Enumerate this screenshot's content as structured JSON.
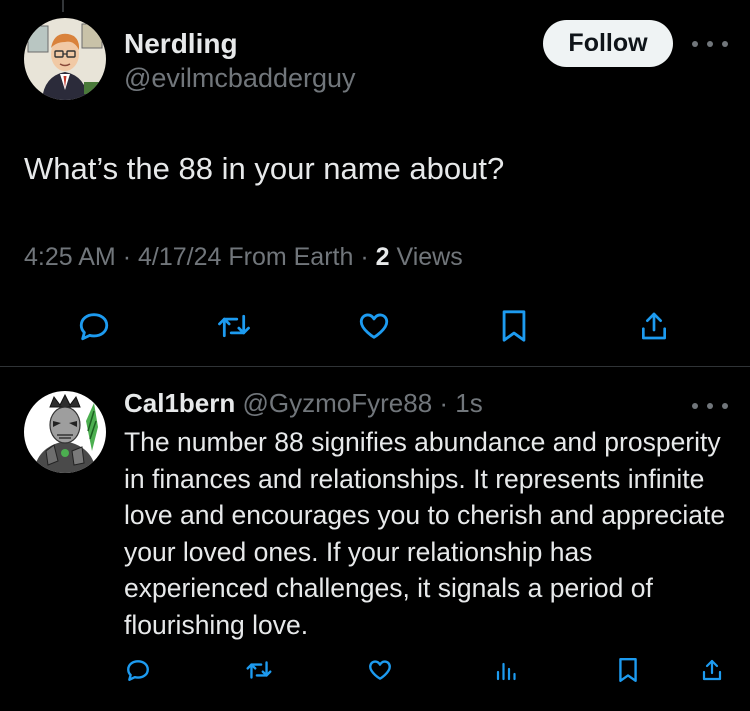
{
  "main_tweet": {
    "display_name": "Nerdling",
    "handle": "@evilmcbadderguy",
    "follow_label": "Follow",
    "text": "What’s the 88 in your name about?",
    "time": "4:25 AM",
    "date": "4/17/24",
    "location": "From Earth",
    "views_count": "2",
    "views_label": "Views",
    "actions": [
      "reply-icon",
      "retweet-icon",
      "like-icon",
      "bookmark-icon",
      "share-icon"
    ]
  },
  "reply": {
    "display_name": "Cal1bern",
    "handle": "@GyzmoFyre88",
    "time": "1s",
    "text": "The number 88 signifies abundance and prosperity in finances and relationships. It represents infinite love and encourages you to cherish and appreciate your loved ones. If your relationship has experienced challenges, it signals a period of flourishing love.",
    "actions": [
      "reply-icon",
      "retweet-icon",
      "like-icon",
      "views-icon",
      "bookmark-icon",
      "share-icon"
    ]
  },
  "colors": {
    "background": "#000000",
    "text_primary": "#e7e9ea",
    "text_secondary": "#71767b",
    "follow_bg": "#eff3f4",
    "divider": "#2f3336"
  }
}
